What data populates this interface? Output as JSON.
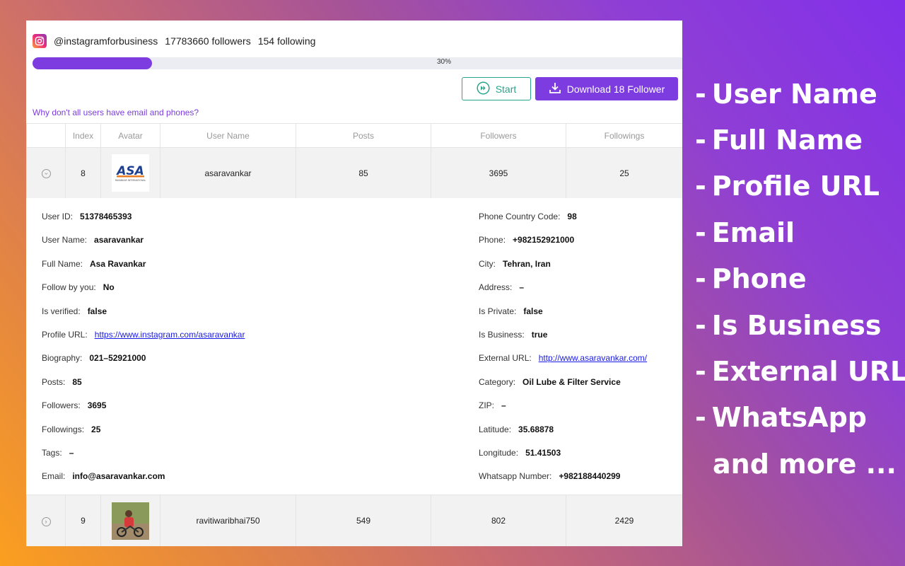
{
  "header": {
    "username": "@instagramforbusiness",
    "followers": "17783660 followers",
    "following": "154 following"
  },
  "progress": {
    "percent": 30,
    "label": "30%"
  },
  "buttons": {
    "start": "Start",
    "download": "Download 18 Follower"
  },
  "help_link": "Why don't all users have email and phones?",
  "table": {
    "columns": [
      "",
      "Index",
      "Avatar",
      "User Name",
      "Posts",
      "Followers",
      "Followings"
    ],
    "rows": [
      {
        "index": "8",
        "username": "asaravankar",
        "posts": "85",
        "followers": "3695",
        "followings": "25",
        "avatar_text": "ASA",
        "avatar_subtext": "RAVANKAR INTERNATIONAL"
      },
      {
        "index": "9",
        "username": "ravitiwaribhai750",
        "posts": "549",
        "followers": "802",
        "followings": "2429"
      }
    ]
  },
  "details": {
    "left": [
      {
        "label": "User ID:",
        "value": "51378465393"
      },
      {
        "label": "User Name:",
        "value": "asaravankar"
      },
      {
        "label": "Full Name:",
        "value": "Asa Ravankar"
      },
      {
        "label": "Follow by you:",
        "value": "No"
      },
      {
        "label": "Is verified:",
        "value": "false"
      },
      {
        "label": "Profile URL:",
        "value": "https://www.instagram.com/asaravankar",
        "link": true
      },
      {
        "label": "Biography:",
        "value": "021–52921000"
      },
      {
        "label": "Posts:",
        "value": "85"
      },
      {
        "label": "Followers:",
        "value": "3695"
      },
      {
        "label": "Followings:",
        "value": "25"
      },
      {
        "label": "Tags:",
        "value": "–"
      },
      {
        "label": "Email:",
        "value": "info@asaravankar.com"
      }
    ],
    "right": [
      {
        "label": "Phone Country Code:",
        "value": "98"
      },
      {
        "label": "Phone:",
        "value": "+982152921000"
      },
      {
        "label": "City:",
        "value": "Tehran, Iran"
      },
      {
        "label": "Address:",
        "value": "–"
      },
      {
        "label": "Is Private:",
        "value": "false"
      },
      {
        "label": "Is Business:",
        "value": "true"
      },
      {
        "label": "External URL:",
        "value": "http://www.asaravankar.com/",
        "link": true
      },
      {
        "label": "Category:",
        "value": "Oil Lube & Filter Service"
      },
      {
        "label": "ZIP:",
        "value": "–"
      },
      {
        "label": "Latitude:",
        "value": "35.68878"
      },
      {
        "label": "Longitude:",
        "value": "51.41503"
      },
      {
        "label": "Whatsapp Number:",
        "value": "+982188440299"
      }
    ]
  },
  "features": [
    {
      "dash": "-",
      "text": "User Name"
    },
    {
      "dash": "-",
      "text": "Full Name"
    },
    {
      "dash": "-",
      "text": "Profile URL"
    },
    {
      "dash": "-",
      "text": "Email"
    },
    {
      "dash": "-",
      "text": "Phone"
    },
    {
      "dash": "-",
      "text": "Is Business"
    },
    {
      "dash": "-",
      "text": "External URL"
    },
    {
      "dash": "-",
      "text": "WhatsApp"
    },
    {
      "dash": "",
      "text": "and more ..."
    }
  ],
  "colors": {
    "accent": "#7d3cdf",
    "start_green": "#2aa58c",
    "link_blue": "#1a1ae6"
  },
  "icons": {
    "brand": "instagram-icon",
    "start": "fast-forward-icon",
    "download": "download-icon",
    "row_toggle": "chevron-circle-icon"
  }
}
